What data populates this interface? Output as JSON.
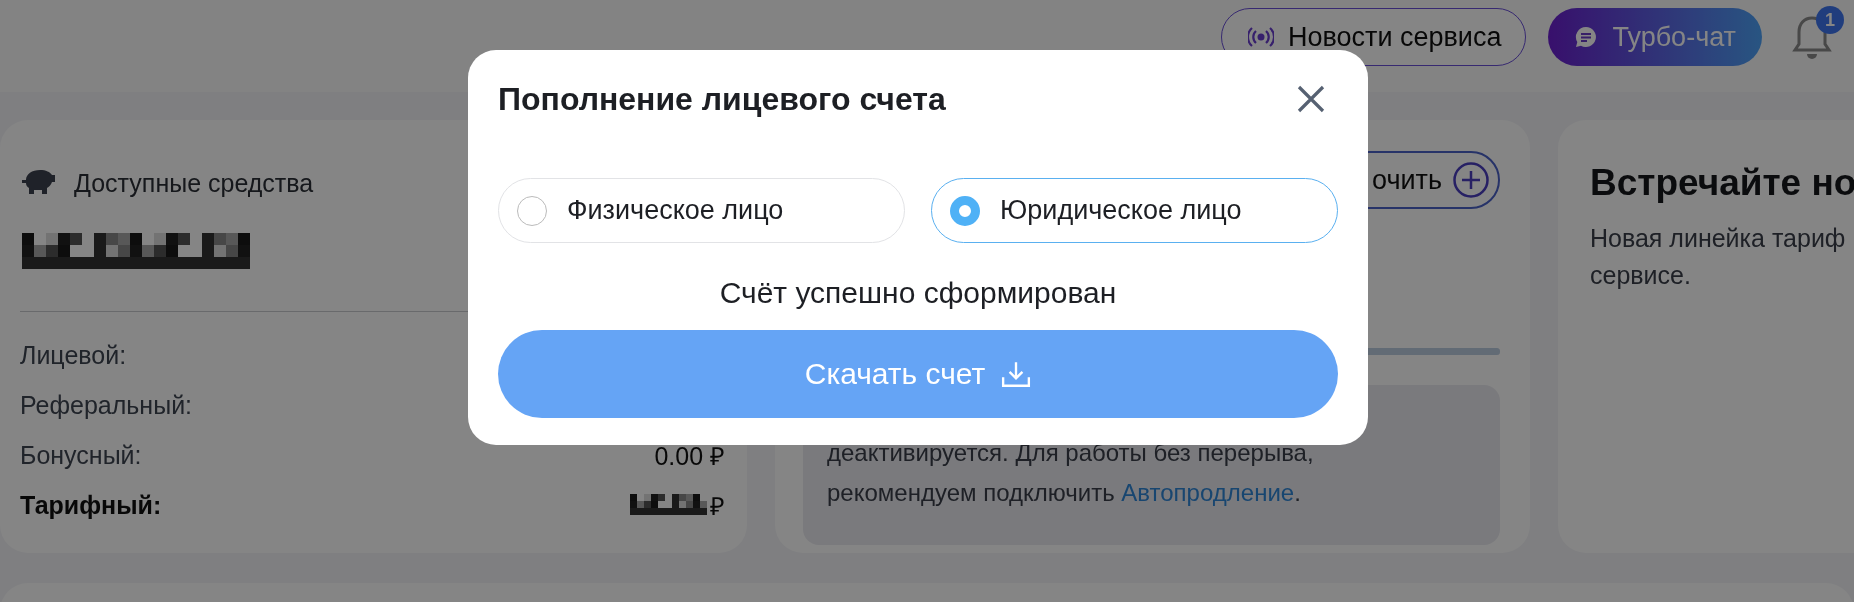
{
  "header": {
    "news_button": "Новости сервиса",
    "chat_button": "Турбо-чат",
    "notification_badge": "1"
  },
  "balance_card": {
    "title": "Доступные средства",
    "rows": [
      {
        "label": "Лицевой:",
        "bold": false
      },
      {
        "label": "Реферальный:",
        "bold": false
      },
      {
        "label": "Бонусный:",
        "bold": false,
        "value": "0.00 ₽"
      },
      {
        "label": "Тарифный:",
        "bold": true,
        "value": "₽",
        "redacted": true
      }
    ]
  },
  "subscription_card": {
    "connect_button": "очить",
    "progress": {
      "level": 1
    },
    "notice": {
      "text": "деактивируется. Для работы без перерыва, рекомендуем подключить",
      "link": "Автопродление",
      "after": "."
    }
  },
  "promo_card": {
    "title": "Встречайте но",
    "text_lines": [
      "Новая линейка тариф",
      "сервисе."
    ]
  },
  "modal": {
    "title": "Пополнение лицевого счета",
    "options": [
      {
        "label": "Физическое лицо",
        "selected": false
      },
      {
        "label": "Юридическое лицо",
        "selected": true
      }
    ],
    "status": "Счёт успешно сформирован",
    "download_button": "Скачать счет"
  }
}
